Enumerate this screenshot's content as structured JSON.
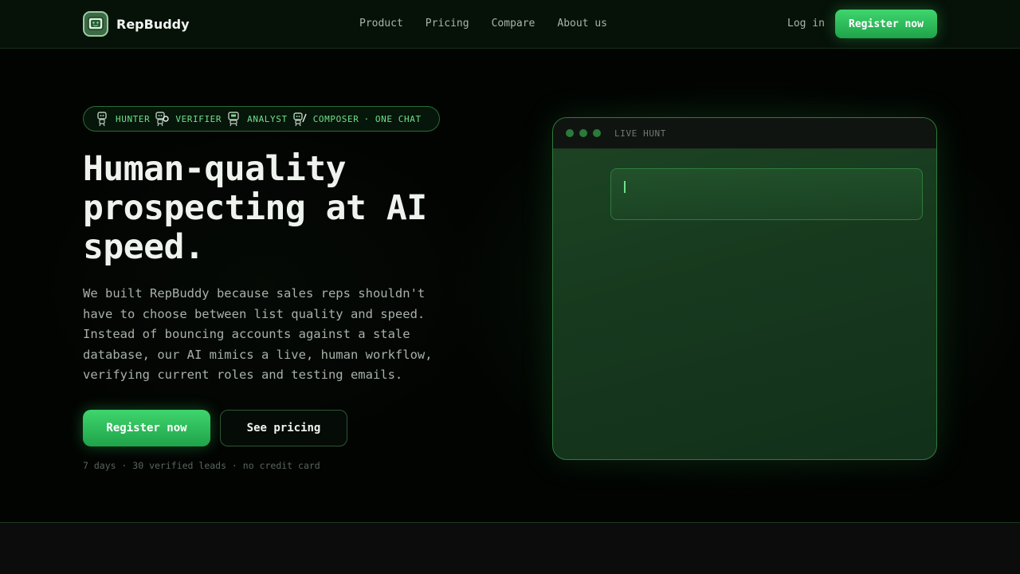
{
  "brand": {
    "name": "RepBuddy",
    "logo_icon": "robot-face-icon"
  },
  "nav": {
    "links": [
      "Product",
      "Pricing",
      "Compare",
      "About us"
    ],
    "login_label": "Log in",
    "register_label": "Register now"
  },
  "hero": {
    "agents": [
      {
        "label": "HUNTER",
        "icon": "hunter-robot-icon"
      },
      {
        "label": "VERIFIER",
        "icon": "verifier-robot-icon"
      },
      {
        "label": "ANALYST",
        "icon": "analyst-robot-icon"
      },
      {
        "label": "COMPOSER",
        "icon": "composer-robot-icon"
      }
    ],
    "agents_suffix": "· ONE CHAT",
    "headline": "Human-quality prospecting at AI speed.",
    "lead": "We built RepBuddy because sales reps shouldn't have to choose between list quality and speed. Instead of bouncing accounts against a stale database, our AI mimics a live, human workflow, verifying current roles and testing emails.",
    "primary_cta": "Register now",
    "secondary_cta": "See pricing",
    "fine_print": "7 days · 30 verified leads · no credit card"
  },
  "window": {
    "title": "LIVE HUNT"
  },
  "colors": {
    "accent": "#3fd56d",
    "accent_dark": "#1fa34a",
    "background": "#020402",
    "panel": "#173a1e"
  }
}
